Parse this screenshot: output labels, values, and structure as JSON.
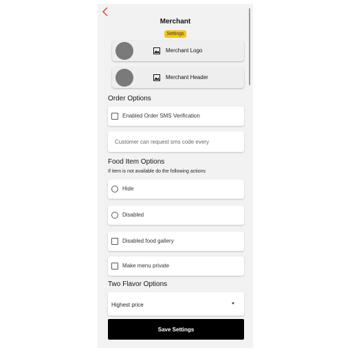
{
  "header": {
    "back_icon": "chevron-left-icon",
    "title": "Merchant",
    "badge": "Settings",
    "badge_color": "#f5c518",
    "back_color": "#e05a4e"
  },
  "media": [
    {
      "label": "Merchant Logo",
      "icon": "image-icon"
    },
    {
      "label": "Merchant Header",
      "icon": "image-icon"
    }
  ],
  "order_options": {
    "heading": "Order Options",
    "sms_verification": {
      "label": "Enabled Order SMS Verification",
      "checked": false
    },
    "sms_request_input": {
      "placeholder": "Customer can request sms code every",
      "value": ""
    }
  },
  "food_item_options": {
    "heading": "Food Item Options",
    "subheading": "If item is not available do the following actions",
    "actions": [
      {
        "label": "Hide",
        "selected": false
      },
      {
        "label": "Disabled",
        "selected": false
      }
    ],
    "disabled_food_gallery": {
      "label": "Disabled food gallery",
      "checked": false
    },
    "make_menu_private": {
      "label": "Make menu private",
      "checked": false
    }
  },
  "two_flavor_options": {
    "heading": "Two Flavor Options",
    "selected": "Highest price"
  },
  "save_button": {
    "label": "Save Settings"
  }
}
